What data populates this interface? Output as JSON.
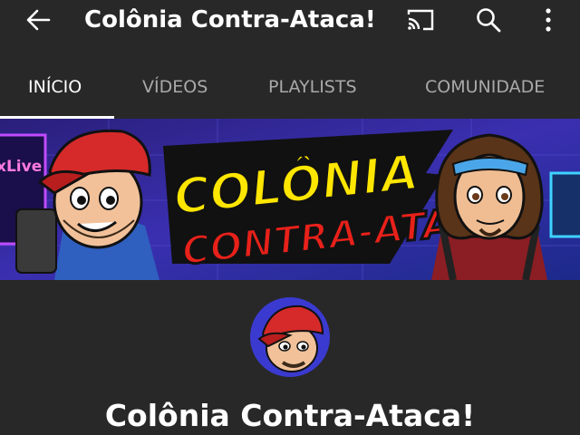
{
  "header": {
    "title": "Colônia Contra-Ataca!",
    "icons": [
      "back-arrow-icon",
      "cast-icon",
      "search-icon",
      "more-vert-icon"
    ]
  },
  "tabs": [
    {
      "label": "INÍCIO",
      "active": true
    },
    {
      "label": "VÍDEOS",
      "active": false
    },
    {
      "label": "PLAYLISTS",
      "active": false
    },
    {
      "label": "COMUNIDADE",
      "active": false
    }
  ],
  "banner": {
    "logo_line1": "COLÔNIA",
    "logo_line2": "CONTRA-ATACA!",
    "left_sign": "xLive"
  },
  "channel": {
    "name": "Colônia Contra-Ataca!"
  },
  "colors": {
    "background": "#282828",
    "text_primary": "#ffffff",
    "text_secondary": "#a9a9a9",
    "logo_yellow": "#ffe600",
    "logo_red": "#e8211a",
    "cap_red": "#d62a2a"
  }
}
